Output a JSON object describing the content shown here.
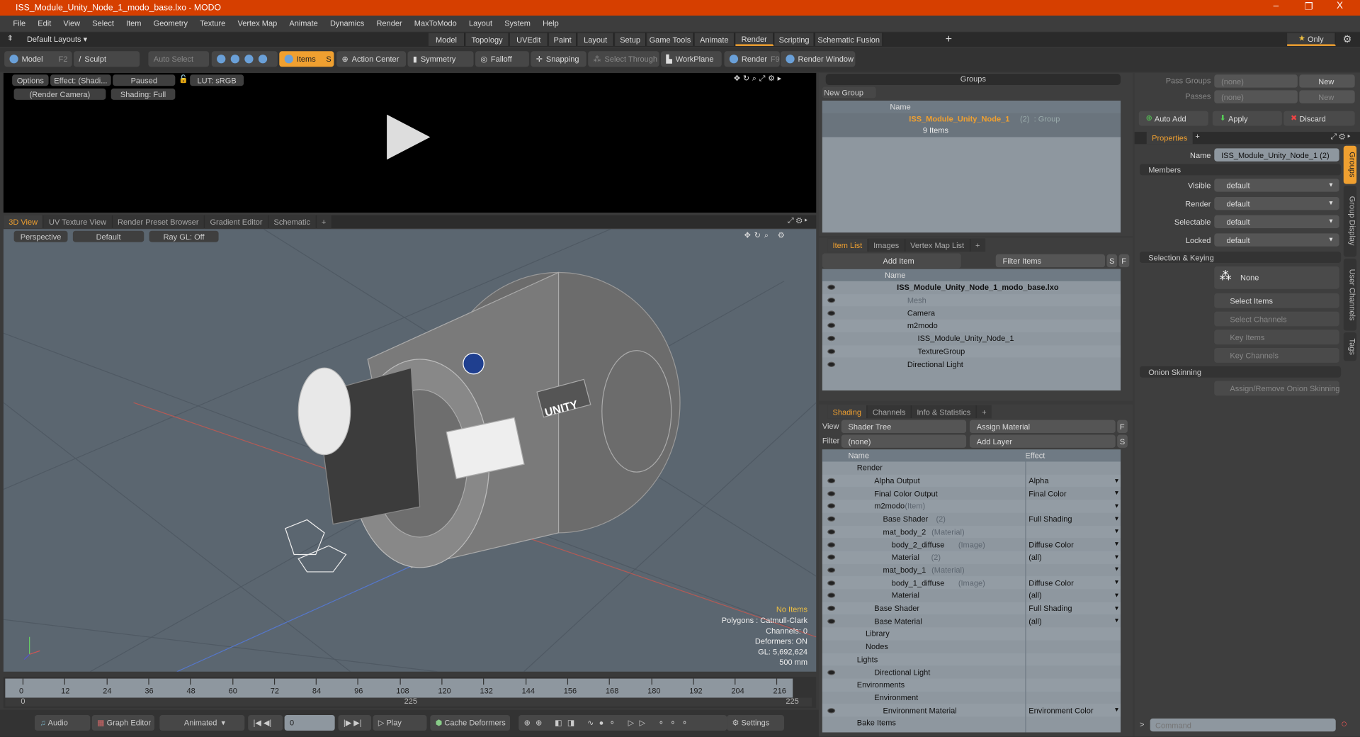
{
  "window": {
    "title": "ISS_Module_Unity_Node_1_modo_base.lxo - MODO",
    "controls": [
      "–",
      "❐",
      "X"
    ]
  },
  "menu": [
    "File",
    "Edit",
    "View",
    "Select",
    "Item",
    "Geometry",
    "Texture",
    "Vertex Map",
    "Animate",
    "Dynamics",
    "Render",
    "MaxToModo",
    "Layout",
    "System",
    "Help"
  ],
  "layouts": {
    "dropdown": "Default Layouts ▾",
    "tabs": [
      "Model",
      "Topology",
      "UVEdit",
      "Paint",
      "Layout",
      "Setup",
      "Game Tools",
      "Animate",
      "Render",
      "Scripting",
      "Schematic Fusion"
    ],
    "active": "Render",
    "only": "Only"
  },
  "toolbar": {
    "model": "Model",
    "model_key": "F2",
    "sculpt": "Sculpt",
    "auto_select": "Auto Select",
    "items": "Items",
    "items_key": "S",
    "action_center": "Action Center",
    "symmetry": "Symmetry",
    "falloff": "Falloff",
    "snapping": "Snapping",
    "select_through": "Select Through",
    "workplane": "WorkPlane",
    "render": "Render",
    "render_key": "F9",
    "render_window": "Render Window"
  },
  "render_view": {
    "options": "Options",
    "effect": "Effect: (Shadi...",
    "paused": "Paused",
    "lut": "LUT: sRGB",
    "camera": "(Render Camera)",
    "shading": "Shading: Full"
  },
  "view_tabs": {
    "tabs": [
      "3D View",
      "UV Texture View",
      "Render Preset Browser",
      "Gradient Editor",
      "Schematic"
    ],
    "active": "3D View"
  },
  "viewport": {
    "perspective": "Perspective",
    "default": "Default",
    "raygl": "Ray GL: Off",
    "hud": {
      "no_items": "No Items",
      "polygons": "Polygons : Catmull-Clark",
      "channels": "Channels: 0",
      "deformers": "Deformers: ON",
      "gl": "GL: 5,692,624",
      "scale": "500 mm"
    },
    "decal": "UNITY"
  },
  "timeline": {
    "ticks": [
      "0",
      "12",
      "24",
      "36",
      "48",
      "60",
      "72",
      "84",
      "96",
      "108",
      "120",
      "132",
      "144",
      "156",
      "168",
      "180",
      "192",
      "204",
      "216"
    ],
    "range_start": "0",
    "range_mid": "225",
    "range_end": "225"
  },
  "bottom": {
    "audio": "Audio",
    "graph_editor": "Graph Editor",
    "animated": "Animated",
    "frame": "0",
    "play": "Play",
    "cache": "Cache Deformers",
    "settings": "Settings"
  },
  "groups": {
    "title": "Groups",
    "new_group": "New Group",
    "col_name": "Name",
    "group_name": "ISS_Module_Unity_Node_1",
    "group_count": "(2)",
    "group_type": ": Group",
    "items_count": "9 Items"
  },
  "item_list": {
    "tabs": [
      "Item List",
      "Images",
      "Vertex Map List"
    ],
    "add_item": "Add Item",
    "filter": "Filter Items",
    "s": "S",
    "f": "F",
    "col_name": "Name",
    "rows": [
      {
        "label": "ISS_Module_Unity_Node_1_modo_base.lxo",
        "indent": 0,
        "bold": true
      },
      {
        "label": "Mesh",
        "indent": 1,
        "dim": true
      },
      {
        "label": "Camera",
        "indent": 1
      },
      {
        "label": "m2modo",
        "indent": 1
      },
      {
        "label": "ISS_Module_Unity_Node_1",
        "indent": 2
      },
      {
        "label": "TextureGroup",
        "indent": 2
      },
      {
        "label": "Directional Light",
        "indent": 1
      }
    ]
  },
  "shading": {
    "tabs": [
      "Shading",
      "Channels",
      "Info & Statistics"
    ],
    "view_label": "View",
    "view_value": "Shader Tree",
    "assign": "Assign Material",
    "f": "F",
    "filter_label": "Filter",
    "filter_value": "(none)",
    "add_layer": "Add Layer",
    "s": "S",
    "col_name": "Name",
    "col_effect": "Effect",
    "rows": [
      {
        "name": "Render",
        "indent": 0,
        "eye": false
      },
      {
        "name": "Alpha Output",
        "indent": 2,
        "effect": "Alpha",
        "eye": true
      },
      {
        "name": "Final Color Output",
        "indent": 2,
        "effect": "Final Color",
        "eye": true
      },
      {
        "name": "m2modo",
        "sub": "(Item)",
        "indent": 2,
        "effect": "",
        "eye": true
      },
      {
        "name": "Base Shader",
        "sub": "(2)",
        "indent": 3,
        "effect": "Full Shading",
        "eye": true
      },
      {
        "name": "mat_body_2",
        "sub": "(Material)",
        "indent": 3,
        "effect": "",
        "eye": true
      },
      {
        "name": "body_2_diffuse",
        "sub": "(Image)",
        "indent": 4,
        "effect": "Diffuse Color",
        "eye": true
      },
      {
        "name": "Material",
        "sub": "(2)",
        "indent": 4,
        "effect": "(all)",
        "eye": true
      },
      {
        "name": "mat_body_1",
        "sub": "(Material)",
        "indent": 3,
        "effect": "",
        "eye": true
      },
      {
        "name": "body_1_diffuse",
        "sub": "(Image)",
        "indent": 4,
        "effect": "Diffuse Color",
        "eye": true
      },
      {
        "name": "Material",
        "indent": 4,
        "effect": "(all)",
        "eye": true
      },
      {
        "name": "Base Shader",
        "indent": 2,
        "effect": "Full Shading",
        "eye": true
      },
      {
        "name": "Base Material",
        "indent": 2,
        "effect": "(all)",
        "eye": true
      },
      {
        "name": "Library",
        "indent": 1,
        "eye": false
      },
      {
        "name": "Nodes",
        "indent": 1,
        "eye": false
      },
      {
        "name": "Lights",
        "indent": 0,
        "eye": false
      },
      {
        "name": "Directional Light",
        "indent": 2,
        "eye": true
      },
      {
        "name": "Environments",
        "indent": 0,
        "eye": false
      },
      {
        "name": "Environment",
        "indent": 2,
        "eye": false
      },
      {
        "name": "Environment Material",
        "indent": 3,
        "effect": "Environment Color",
        "eye": true
      },
      {
        "name": "Bake Items",
        "indent": 0,
        "eye": false
      }
    ]
  },
  "passes": {
    "pass_groups": "Pass Groups",
    "passes": "Passes",
    "none": "(none)",
    "new": "New",
    "auto_add": "Auto Add",
    "apply": "Apply",
    "discard": "Discard"
  },
  "properties": {
    "tab": "Properties",
    "name_label": "Name",
    "name_value": "ISS_Module_Unity_Node_1 (2)",
    "members": "Members",
    "fields": [
      {
        "label": "Visible",
        "value": "default"
      },
      {
        "label": "Render",
        "value": "default"
      },
      {
        "label": "Selectable",
        "value": "default"
      },
      {
        "label": "Locked",
        "value": "default"
      }
    ],
    "selection_keying": "Selection & Keying",
    "none": "None",
    "select_items": "Select Items",
    "select_channels": "Select Channels",
    "key_items": "Key Items",
    "key_channels": "Key Channels",
    "onion": "Onion Skinning",
    "assign_onion": "Assign/Remove Onion Skinning",
    "side_tabs": [
      "Groups",
      "Group Display",
      "User Channels",
      "Tags"
    ]
  },
  "command": {
    "placeholder": "Command"
  },
  "colors": {
    "accent": "#f0a030",
    "titlebar": "#d63f00",
    "viewport": "#5b6670"
  }
}
